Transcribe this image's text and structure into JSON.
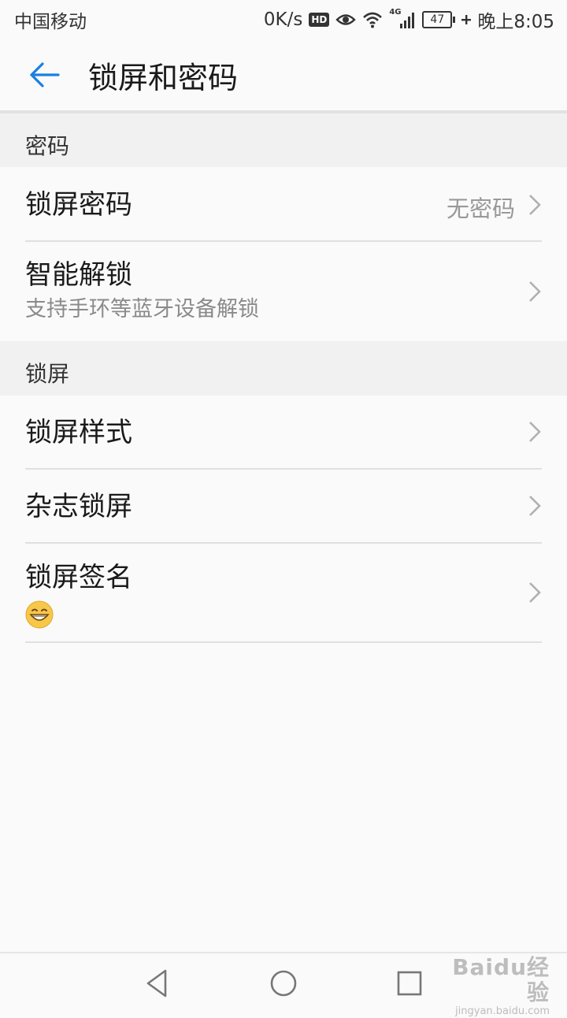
{
  "status_bar": {
    "carrier": "中国移动",
    "net_speed": "0K/s",
    "hd_badge": "HD",
    "network_type": "4G",
    "battery_level": "47",
    "time": "晚上8:05"
  },
  "header": {
    "title": "锁屏和密码"
  },
  "sections": [
    {
      "header": "密码",
      "items": [
        {
          "title": "锁屏密码",
          "value": "无密码"
        },
        {
          "title": "智能解锁",
          "subtitle": "支持手环等蓝牙设备解锁"
        }
      ]
    },
    {
      "header": "锁屏",
      "items": [
        {
          "title": "锁屏样式"
        },
        {
          "title": "杂志锁屏"
        },
        {
          "title": "锁屏签名",
          "subtitle_icon": "grinning-face-emoji"
        }
      ]
    }
  ],
  "watermark": {
    "brand": "Baidu经验",
    "url": "jingyan.baidu.com"
  },
  "colors": {
    "accent": "#1a7fe0",
    "section_bg": "#f1f1f1",
    "page_bg": "#fafafa"
  }
}
